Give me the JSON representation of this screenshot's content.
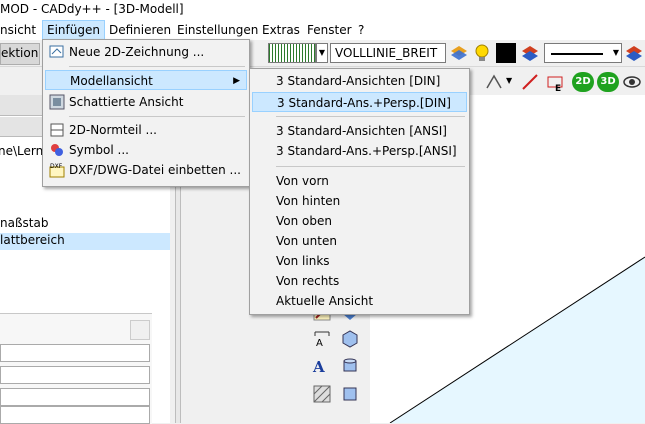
{
  "window": {
    "title": "MOD - CADdy++ - [3D-Modell]"
  },
  "menubar": {
    "items": [
      {
        "label": "nsicht"
      },
      {
        "label": "Einfügen"
      },
      {
        "label": "Definieren"
      },
      {
        "label": "Einstellungen"
      },
      {
        "label": "Extras"
      },
      {
        "label": "Fenster"
      },
      {
        "label": "?"
      }
    ]
  },
  "toolbar": {
    "left_label": "ektion",
    "linetype_combo": "VOLLLINIE_BREIT"
  },
  "left_panel": {
    "path_fragment": "ne\\Lern",
    "row1": "naßstab",
    "row2": "lattbereich"
  },
  "einfuegen_menu": {
    "items": [
      {
        "label": "Neue 2D-Zeichnung ...",
        "icon": "new-drawing-icon"
      },
      {
        "label": "Modellansicht",
        "icon": "",
        "submenu": true
      },
      {
        "label": "Schattierte Ansicht",
        "icon": "shaded-view-icon"
      },
      {
        "label": "2D-Normteil ...",
        "icon": "standard-part-icon"
      },
      {
        "label": "Symbol ...",
        "icon": "symbol-icon"
      },
      {
        "label": "DXF/DWG-Datei einbetten ...",
        "icon": "dxf-icon"
      }
    ]
  },
  "modellansicht_menu": {
    "items": [
      "3 Standard-Ansichten [DIN]",
      "3 Standard-Ans.+Persp.[DIN]",
      "3 Standard-Ansichten [ANSI]",
      "3 Standard-Ans.+Persp.[ANSI]",
      "Von vorn",
      "Von hinten",
      "Von oben",
      "Von unten",
      "Von links",
      "Von rechts",
      "Aktuelle Ansicht"
    ]
  },
  "toolbar2": {
    "btn_2d": "2D",
    "btn_3d": "3D"
  }
}
